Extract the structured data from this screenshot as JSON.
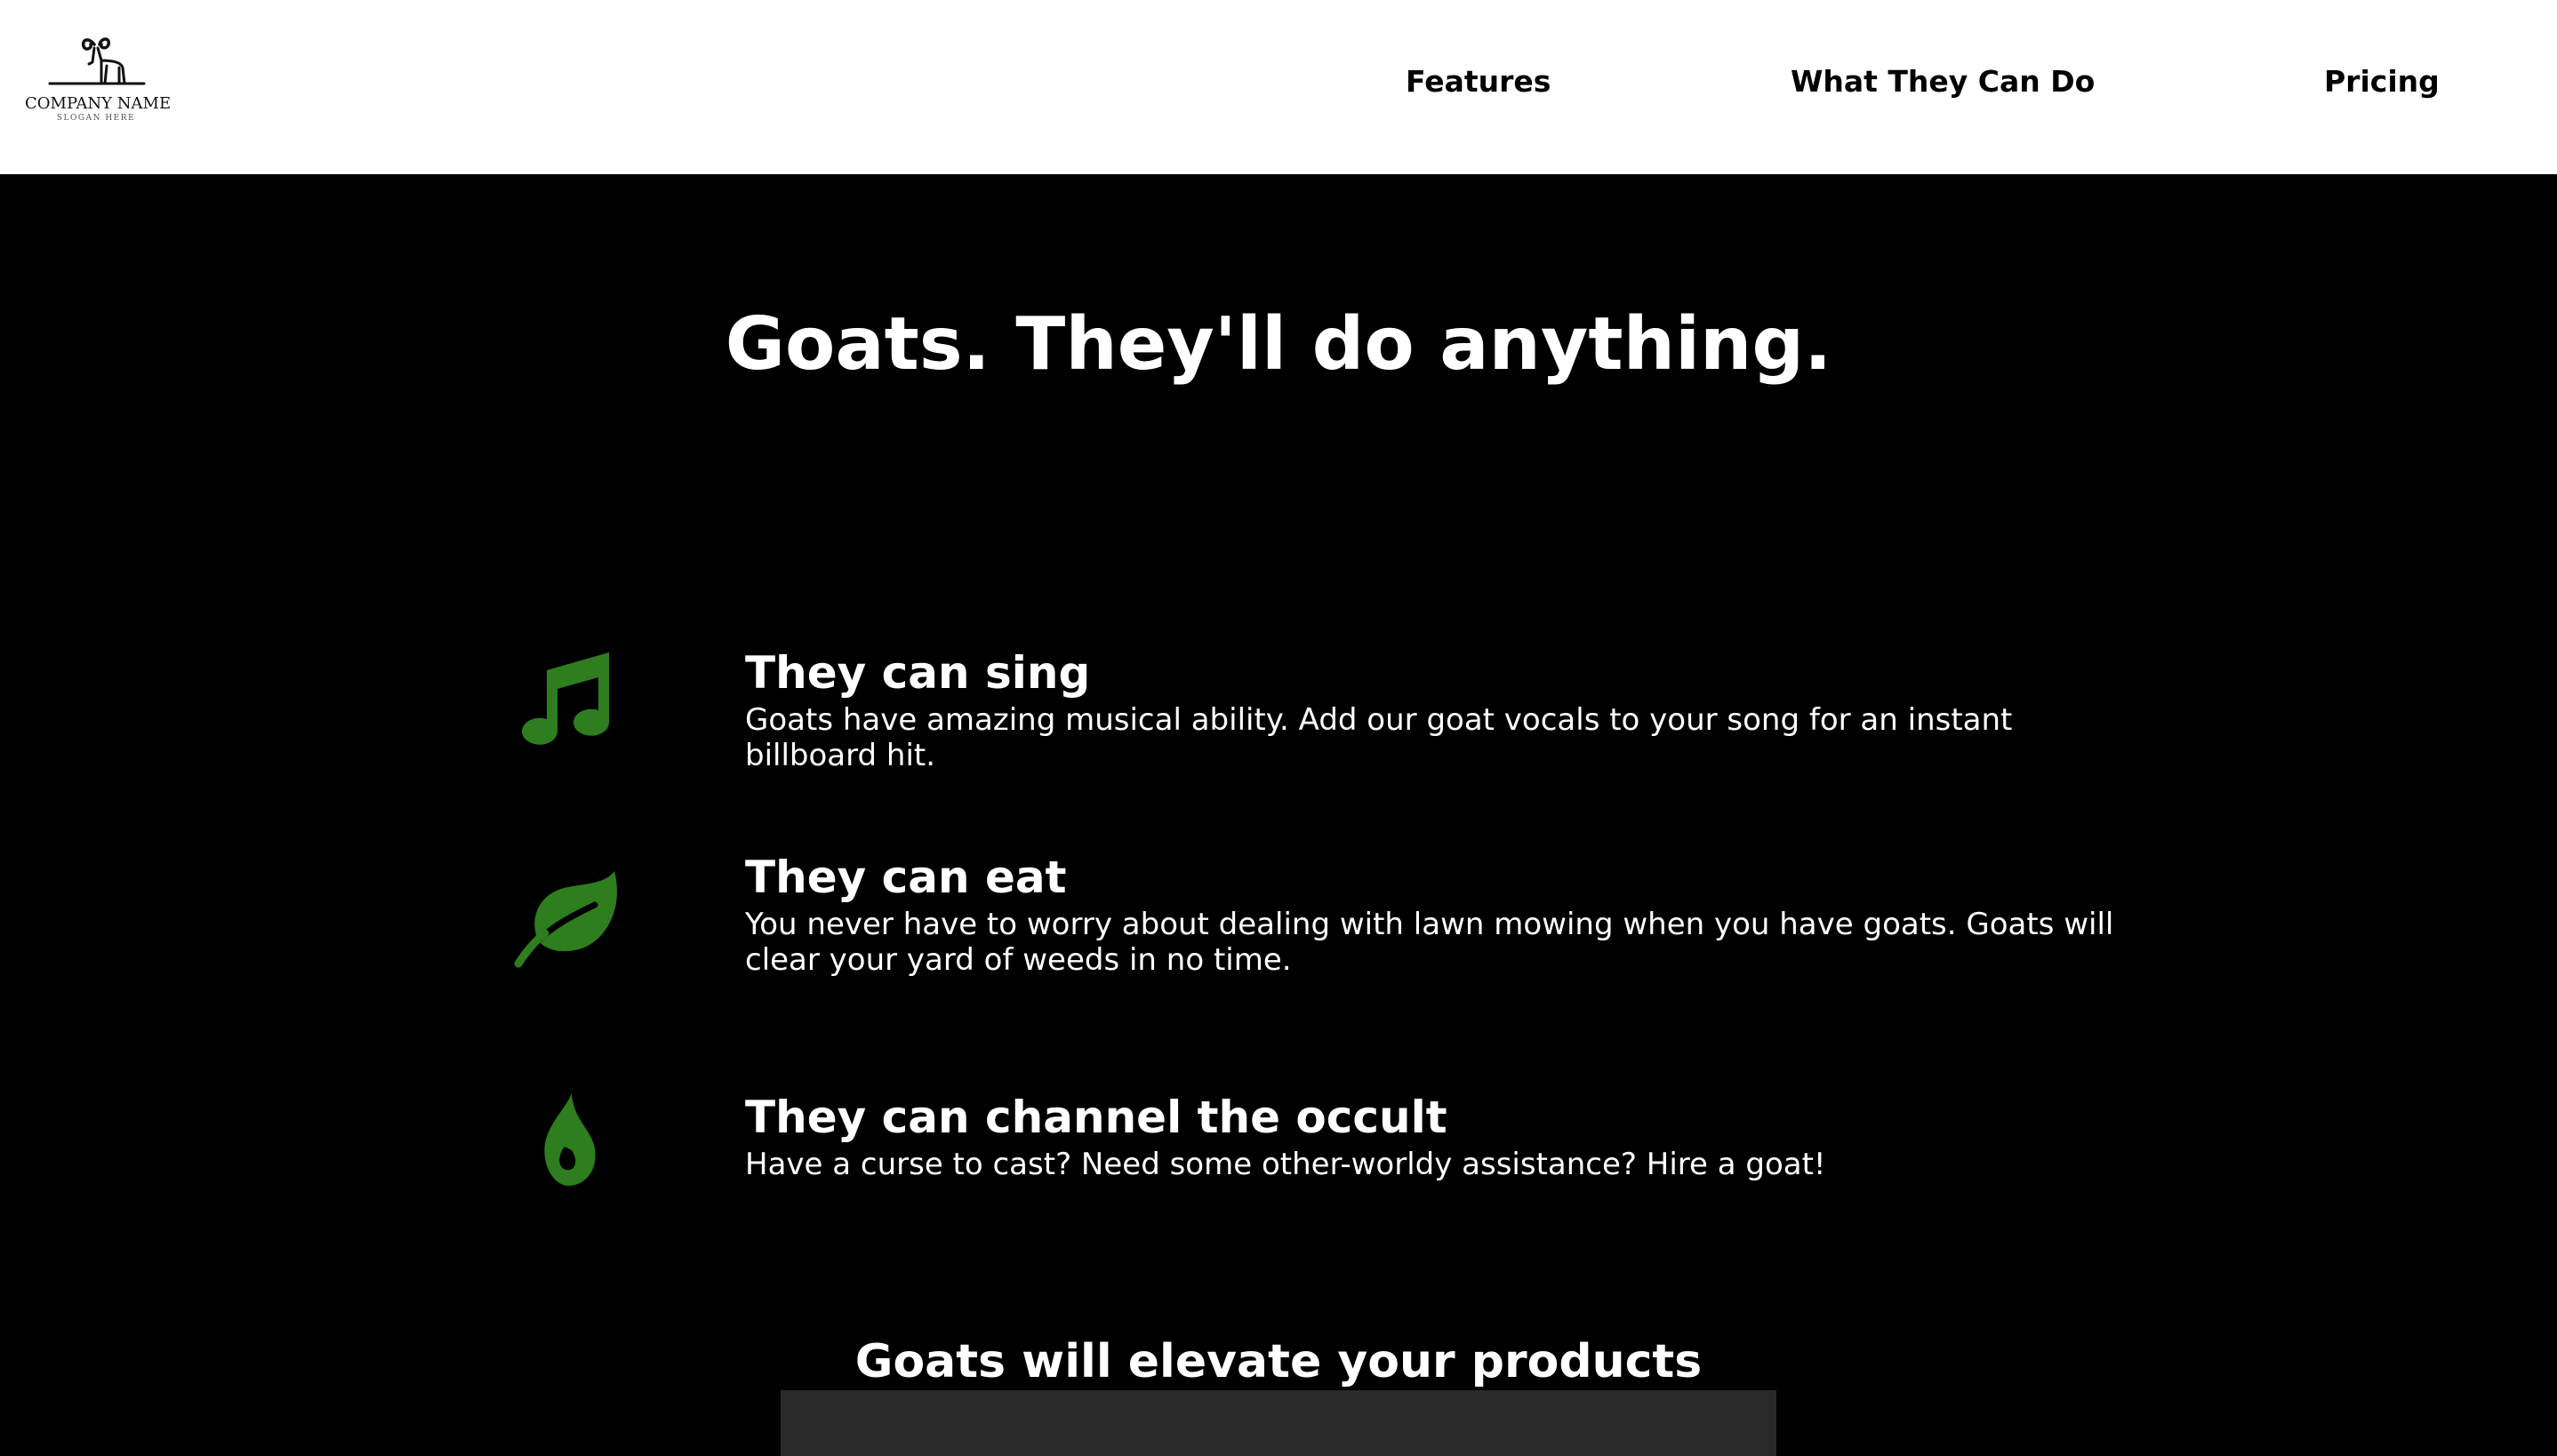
{
  "header": {
    "logo": {
      "company_name": "COMPANY NAME",
      "slogan": "SLOGAN HERE",
      "icon": "goat-logo-icon"
    },
    "nav": [
      {
        "label": "Features"
      },
      {
        "label": "What They Can Do"
      },
      {
        "label": "Pricing"
      }
    ]
  },
  "hero": {
    "title": "Goats. They'll do anything."
  },
  "features": [
    {
      "icon": "music-note-icon",
      "title": "They can sing",
      "description": "Goats have amazing musical ability. Add our goat vocals to your song for an instant billboard hit."
    },
    {
      "icon": "leaf-icon",
      "title": "They can eat",
      "description": "You never have to worry about dealing with lawn mowing when you have goats. Goats will clear your yard of weeds in no time."
    },
    {
      "icon": "fire-icon",
      "title": "They can channel the occult",
      "description": "Have a curse to cast? Need some other-worldy assistance? Hire a goat!"
    }
  ],
  "products": {
    "title": "Goats will elevate your products"
  },
  "colors": {
    "background": "#000000",
    "header": "#ffffff",
    "accent": "#2e7d1e",
    "text": "#ffffff",
    "panel": "#2a2a2a"
  }
}
